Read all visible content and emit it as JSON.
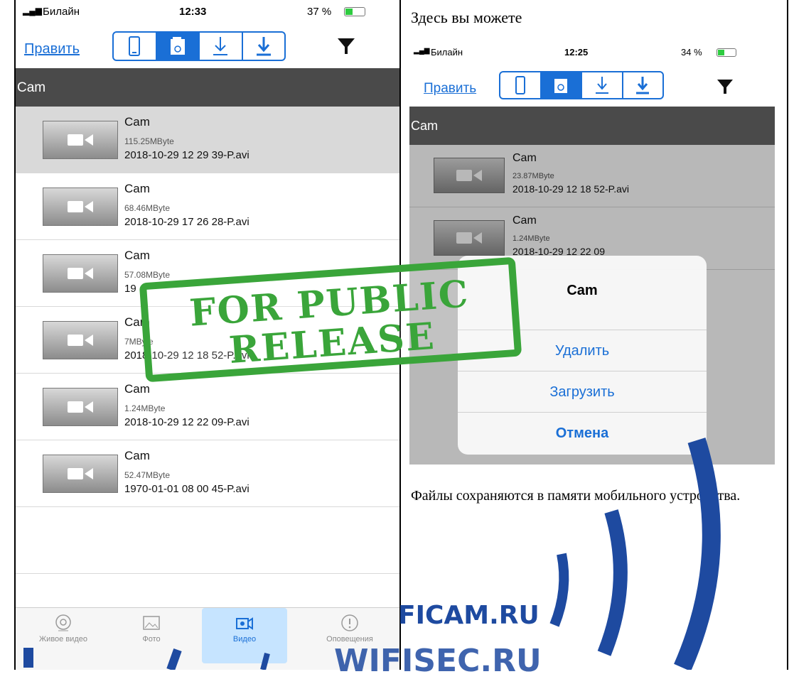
{
  "left_phone": {
    "status": {
      "carrier": "Билайн",
      "time": "12:33",
      "battery": "37 %"
    },
    "nav": {
      "edit": "Править"
    },
    "section": "Cam",
    "rows": [
      {
        "title": "Cam",
        "size": "115.25MByte",
        "file": "2018-10-29 12 29 39-P.avi",
        "selected": true
      },
      {
        "title": "Cam",
        "size": "68.46MByte",
        "file": "2018-10-29 17 26 28-P.avi"
      },
      {
        "title": "Cam",
        "size": "57.08MByte",
        "file": "19"
      },
      {
        "title": "Cam",
        "size": "7MByte",
        "file": "2018-10-29 12 18 52-P.avi"
      },
      {
        "title": "Cam",
        "size": "1.24MByte",
        "file": "2018-10-29 12 22 09-P.avi"
      },
      {
        "title": "Cam",
        "size": "52.47MByte",
        "file": "1970-01-01 08 00 45-P.avi"
      }
    ],
    "tabs": [
      "Живое видео",
      "Фото",
      "Видео",
      "Оповещения"
    ]
  },
  "right": {
    "heading": "Здесь вы можете",
    "phone": {
      "status": {
        "carrier": "Билайн",
        "time": "12:25",
        "battery": "34 %"
      },
      "nav": {
        "edit": "Править"
      },
      "section": "Cam",
      "rows": [
        {
          "title": "Cam",
          "size": "23.87MByte",
          "file": "2018-10-29 12 18 52-P.avi"
        },
        {
          "title": "Cam",
          "size": "1.24MByte",
          "file": "2018-10-29 12 22 09"
        }
      ],
      "dialog": {
        "title": "Cam",
        "delete": "Удалить",
        "download": "Загрузить",
        "cancel": "Отмена"
      }
    },
    "caption": "Файлы сохраняются в памяти мобильного устройства."
  },
  "stamp": {
    "line1": "FOR PUBLIC",
    "line2": "RELEASE"
  },
  "watermark": {
    "line1": "FICAM.RU",
    "line2": "WIFISEC.RU"
  }
}
